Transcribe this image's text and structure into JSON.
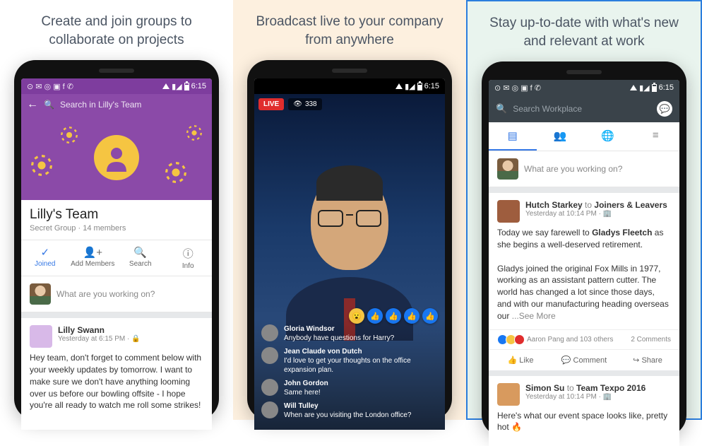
{
  "panels": [
    {
      "caption": "Create and join groups to collaborate on projects"
    },
    {
      "caption": "Broadcast live to your company from anywhere"
    },
    {
      "caption": "Stay up-to-date with what's new and relevant at work"
    }
  ],
  "status_time": "6:15",
  "group": {
    "search_placeholder": "Search in Lilly's Team",
    "name": "Lilly's Team",
    "meta": "Secret Group · 14 members",
    "actions": {
      "joined": "Joined",
      "add": "Add Members",
      "search": "Search",
      "info": "Info"
    },
    "composer": "What are you working on?",
    "post": {
      "author": "Lilly Swann",
      "time": "Yesterday at 6:15 PM",
      "body": "Hey team, don't forget to comment below with your weekly updates by tomorrow. I want to make sure we don't have anything looming over us before our bowling offsite - I hope you're all ready to watch me roll some strikes!"
    }
  },
  "live": {
    "badge": "LIVE",
    "viewers": "338",
    "comments": [
      {
        "name": "Gloria Windsor",
        "text": "Anybody have questions for Harry?"
      },
      {
        "name": "Jean Claude von Dutch",
        "text": "I'd love to get your thoughts on the office expansion plan."
      },
      {
        "name": "John Gordon",
        "text": "Same here!"
      },
      {
        "name": "Will Tulley",
        "text": "When are you visiting the London office?"
      }
    ]
  },
  "feed": {
    "search_placeholder": "Search Workplace",
    "composer": "What are you working on?",
    "post1": {
      "author_from": "Hutch Starkey",
      "author_to_word": "to",
      "author_to": "Joiners & Leavers",
      "time": "Yesterday at 10:14 PM",
      "line1a": "Today we say farewell to ",
      "line1b": "Gladys Fleetch",
      "line1c": " as she begins a well-deserved retirement.",
      "line2": "Gladys joined the original Fox Mills in 1977, working as an assistant pattern cutter. The world has changed a lot since those days, and with our manufacturing heading overseas our ",
      "see_more": "...See More",
      "react_text": "Aaron Pang and 103 others",
      "comments_label": "2 Comments",
      "like": "Like",
      "comment": "Comment",
      "share": "Share"
    },
    "post2": {
      "author_from": "Simon Su",
      "author_to_word": "to",
      "author_to": "Team Texpo 2016",
      "time": "Yesterday at 10:14 PM",
      "body": "Here's what our event space looks like, pretty hot 🔥"
    }
  }
}
